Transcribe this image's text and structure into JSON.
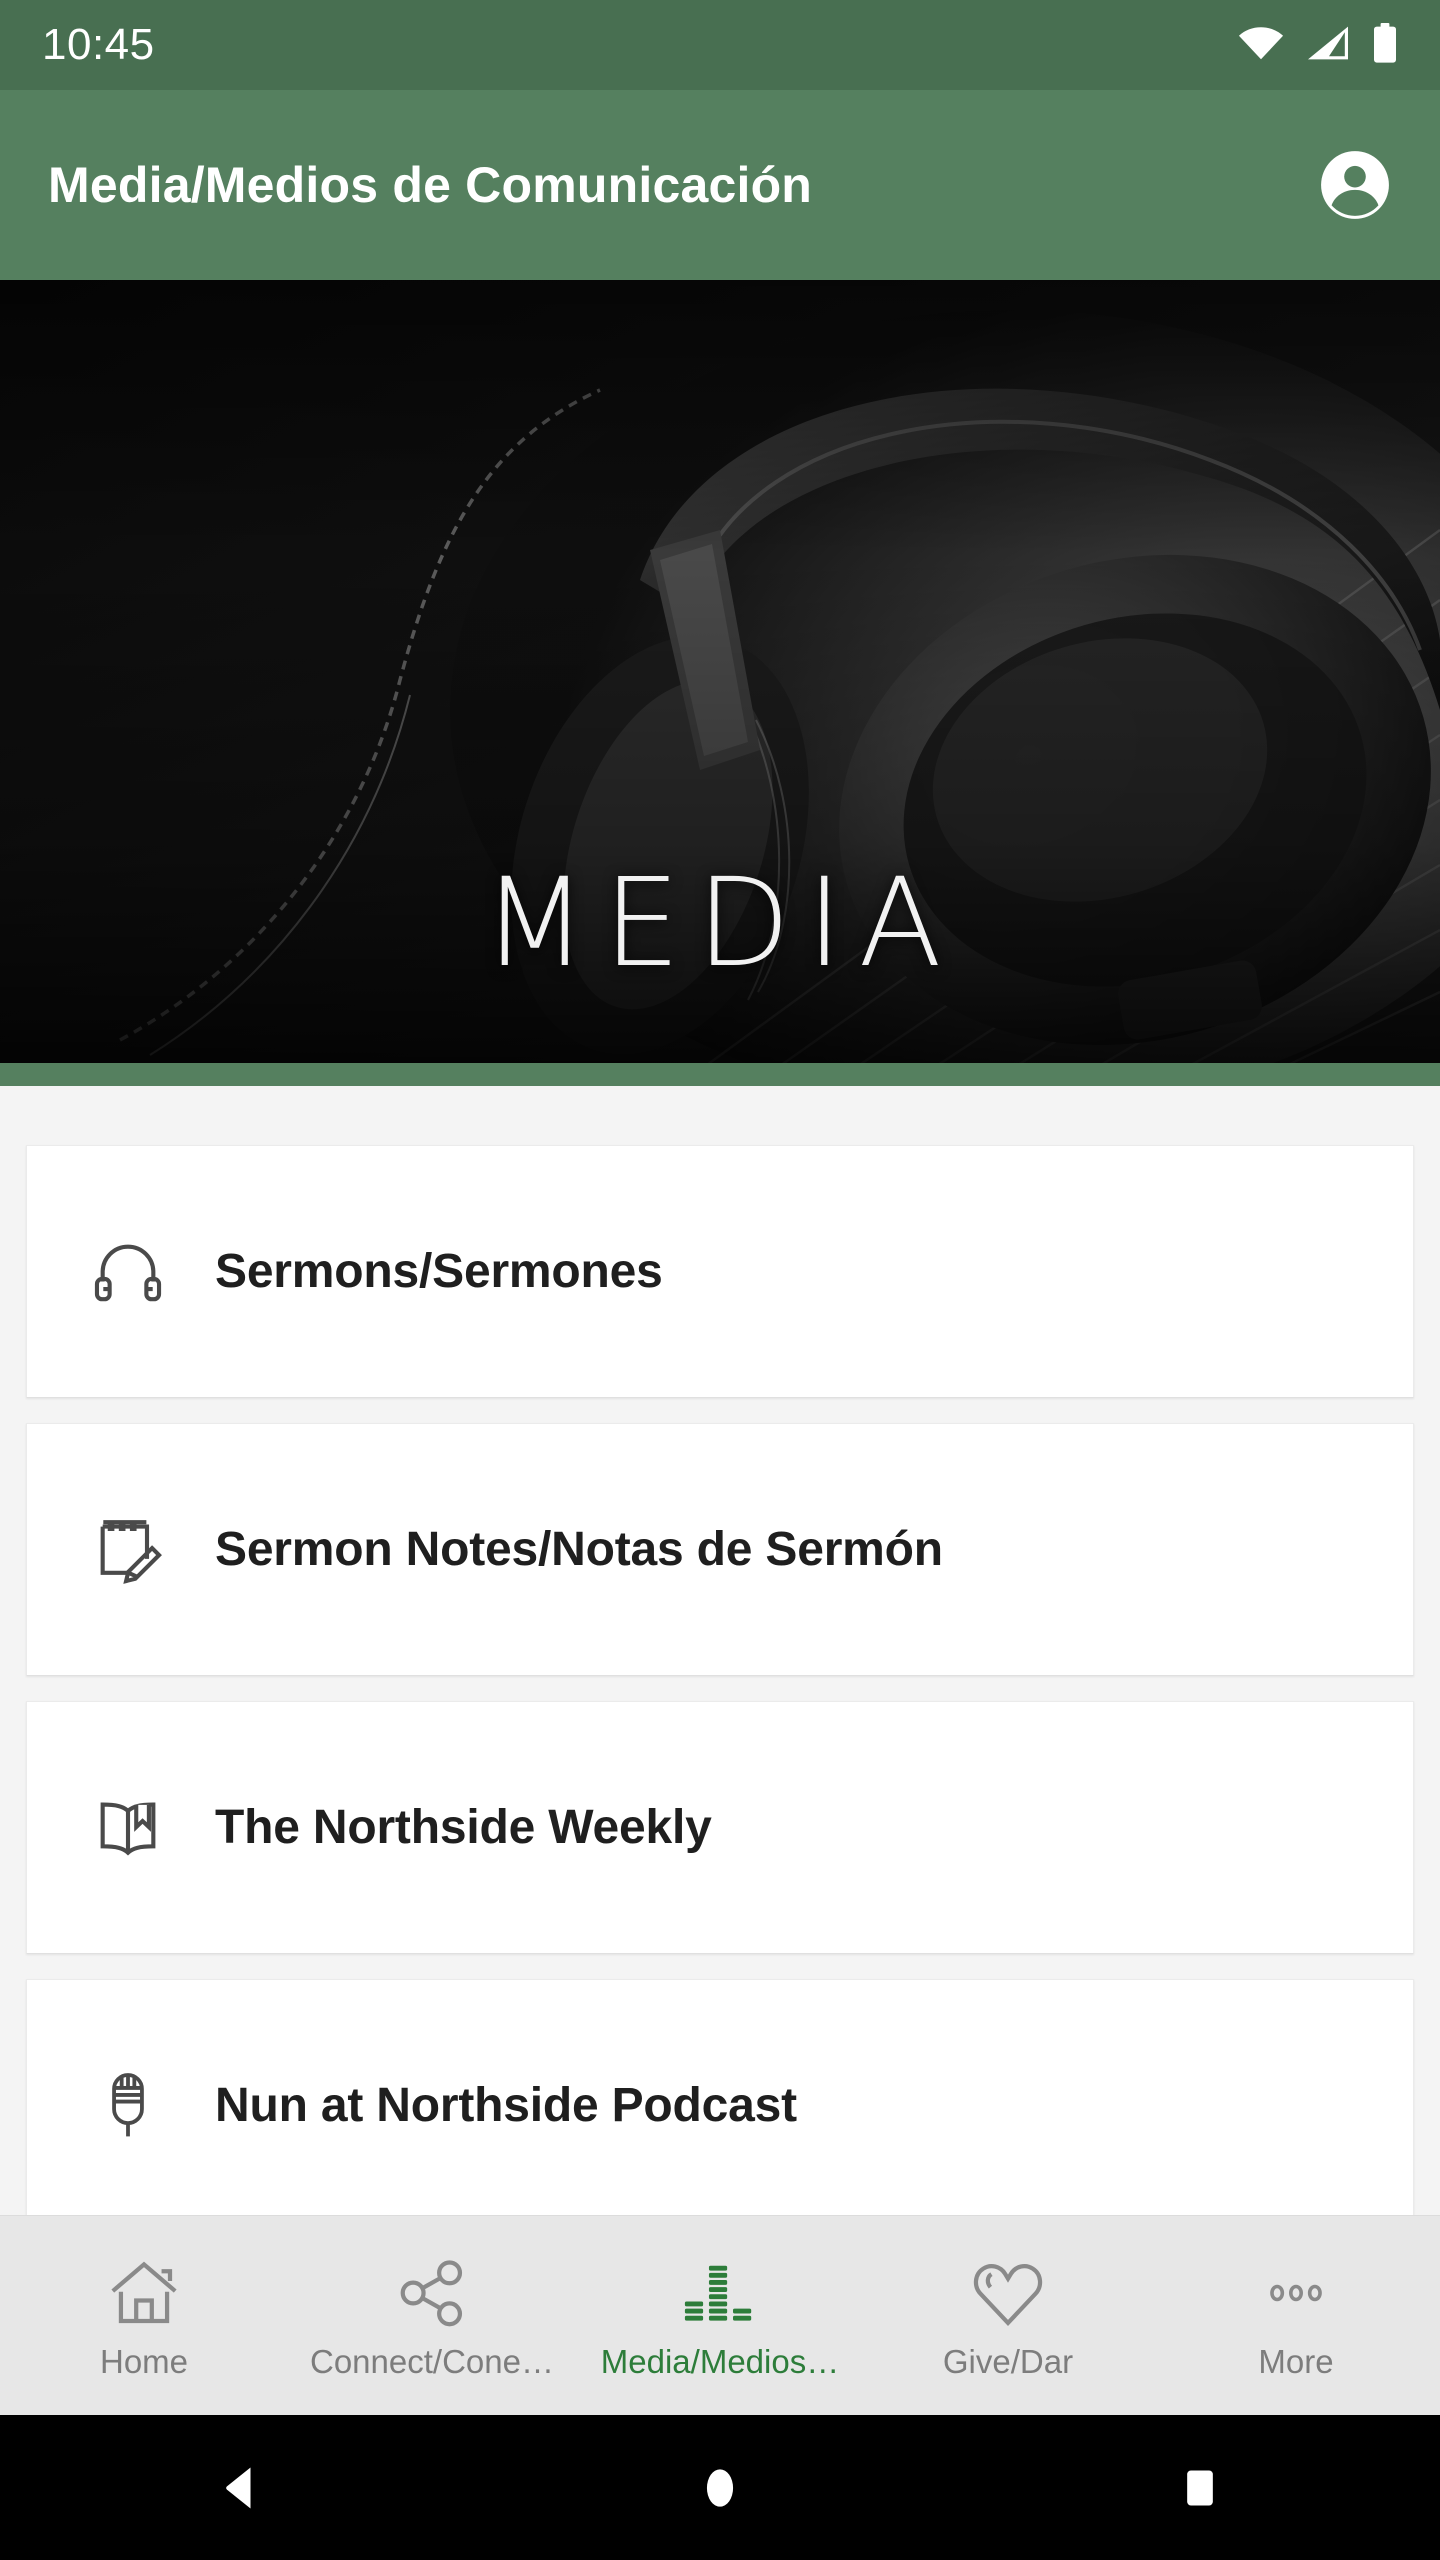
{
  "status_bar": {
    "time": "10:45",
    "icons": [
      "wifi-icon",
      "cellular-signal-icon",
      "battery-icon"
    ],
    "background": "#486f51"
  },
  "app_bar": {
    "title": "Media/Medios de Comunicación",
    "account_icon": "account-circle-icon",
    "background": "#55805f"
  },
  "hero": {
    "caption": "MEDIA",
    "image_description": "headphones-photo",
    "divider_color": "#55805f"
  },
  "list": {
    "items": [
      {
        "label": "Sermons/Sermones",
        "icon": "headphones-icon"
      },
      {
        "label": "Sermon Notes/Notas de Sermón",
        "icon": "notepad-pencil-icon"
      },
      {
        "label": "The Northside Weekly",
        "icon": "open-book-bookmark-icon"
      },
      {
        "label": "Nun at Northside Podcast",
        "icon": "microphone-icon"
      }
    ]
  },
  "bottom_nav": {
    "active_color": "#2d7d3a",
    "inactive_color": "#7d7d7d",
    "items": [
      {
        "label": "Home",
        "icon": "home-icon",
        "active": false
      },
      {
        "label": "Connect/Cone…",
        "icon": "share-icon",
        "active": false
      },
      {
        "label": "Media/Medios…",
        "icon": "equalizer-icon",
        "active": true
      },
      {
        "label": "Give/Dar",
        "icon": "heart-icon",
        "active": false
      },
      {
        "label": "More",
        "icon": "more-dots-icon",
        "active": false
      }
    ]
  },
  "system_nav": {
    "buttons": [
      "back-triangle-icon",
      "home-circle-icon",
      "recents-square-icon"
    ]
  }
}
